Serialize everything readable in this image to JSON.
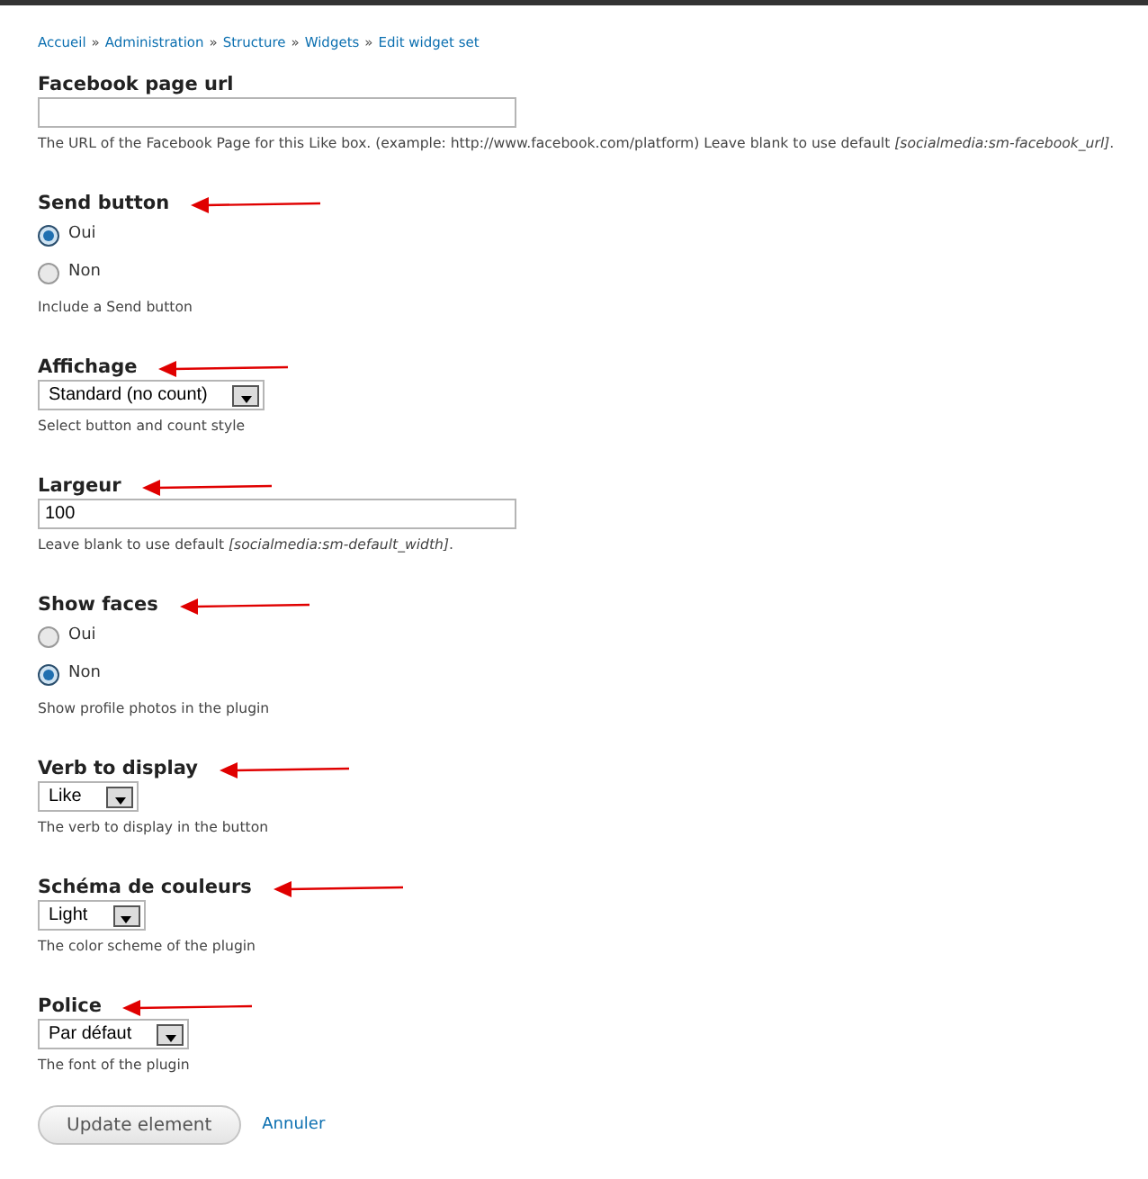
{
  "breadcrumb": [
    "Accueil",
    "Administration",
    "Structure",
    "Widgets",
    "Edit widget set"
  ],
  "breadcrumb_separator": "»",
  "fields": [
    {
      "kind": "text",
      "label": "Facebook page url",
      "annotated": false,
      "description": "The URL of the Facebook Page for this Like box. (example: http://www.facebook.com/platform) Leave blank to use default *[socialmedia:sm-facebook_url]*."
    },
    {
      "kind": "radios",
      "label": "Send button",
      "annotated": true,
      "options": [
        {
          "label": "Oui",
          "selected": true
        },
        {
          "label": "Non",
          "selected": false
        }
      ],
      "description": "Include a Send button"
    },
    {
      "kind": "select",
      "label": "Affichage",
      "annotated": true,
      "value": "Standard (no count)",
      "description": "Select button and count style"
    },
    {
      "kind": "text",
      "label": "Largeur",
      "annotated": true,
      "value": "100",
      "description": "Leave blank to use default *[socialmedia:sm-default_width]*."
    },
    {
      "kind": "radios",
      "label": "Show faces",
      "annotated": true,
      "options": [
        {
          "label": "Oui",
          "selected": false
        },
        {
          "label": "Non",
          "selected": true
        }
      ],
      "description": "Show profile photos in the plugin"
    },
    {
      "kind": "select",
      "label": "Verb to display",
      "annotated": true,
      "value": "Like",
      "description": "The verb to display in the button"
    },
    {
      "kind": "select",
      "label": "Schéma de couleurs",
      "annotated": true,
      "value": "Light",
      "description": "The color scheme of the plugin"
    },
    {
      "kind": "select",
      "label": "Police",
      "annotated": true,
      "value": "Par défaut",
      "description": "The font of the plugin"
    }
  ],
  "actions": {
    "submit": "Update element",
    "cancel": "Annuler"
  }
}
